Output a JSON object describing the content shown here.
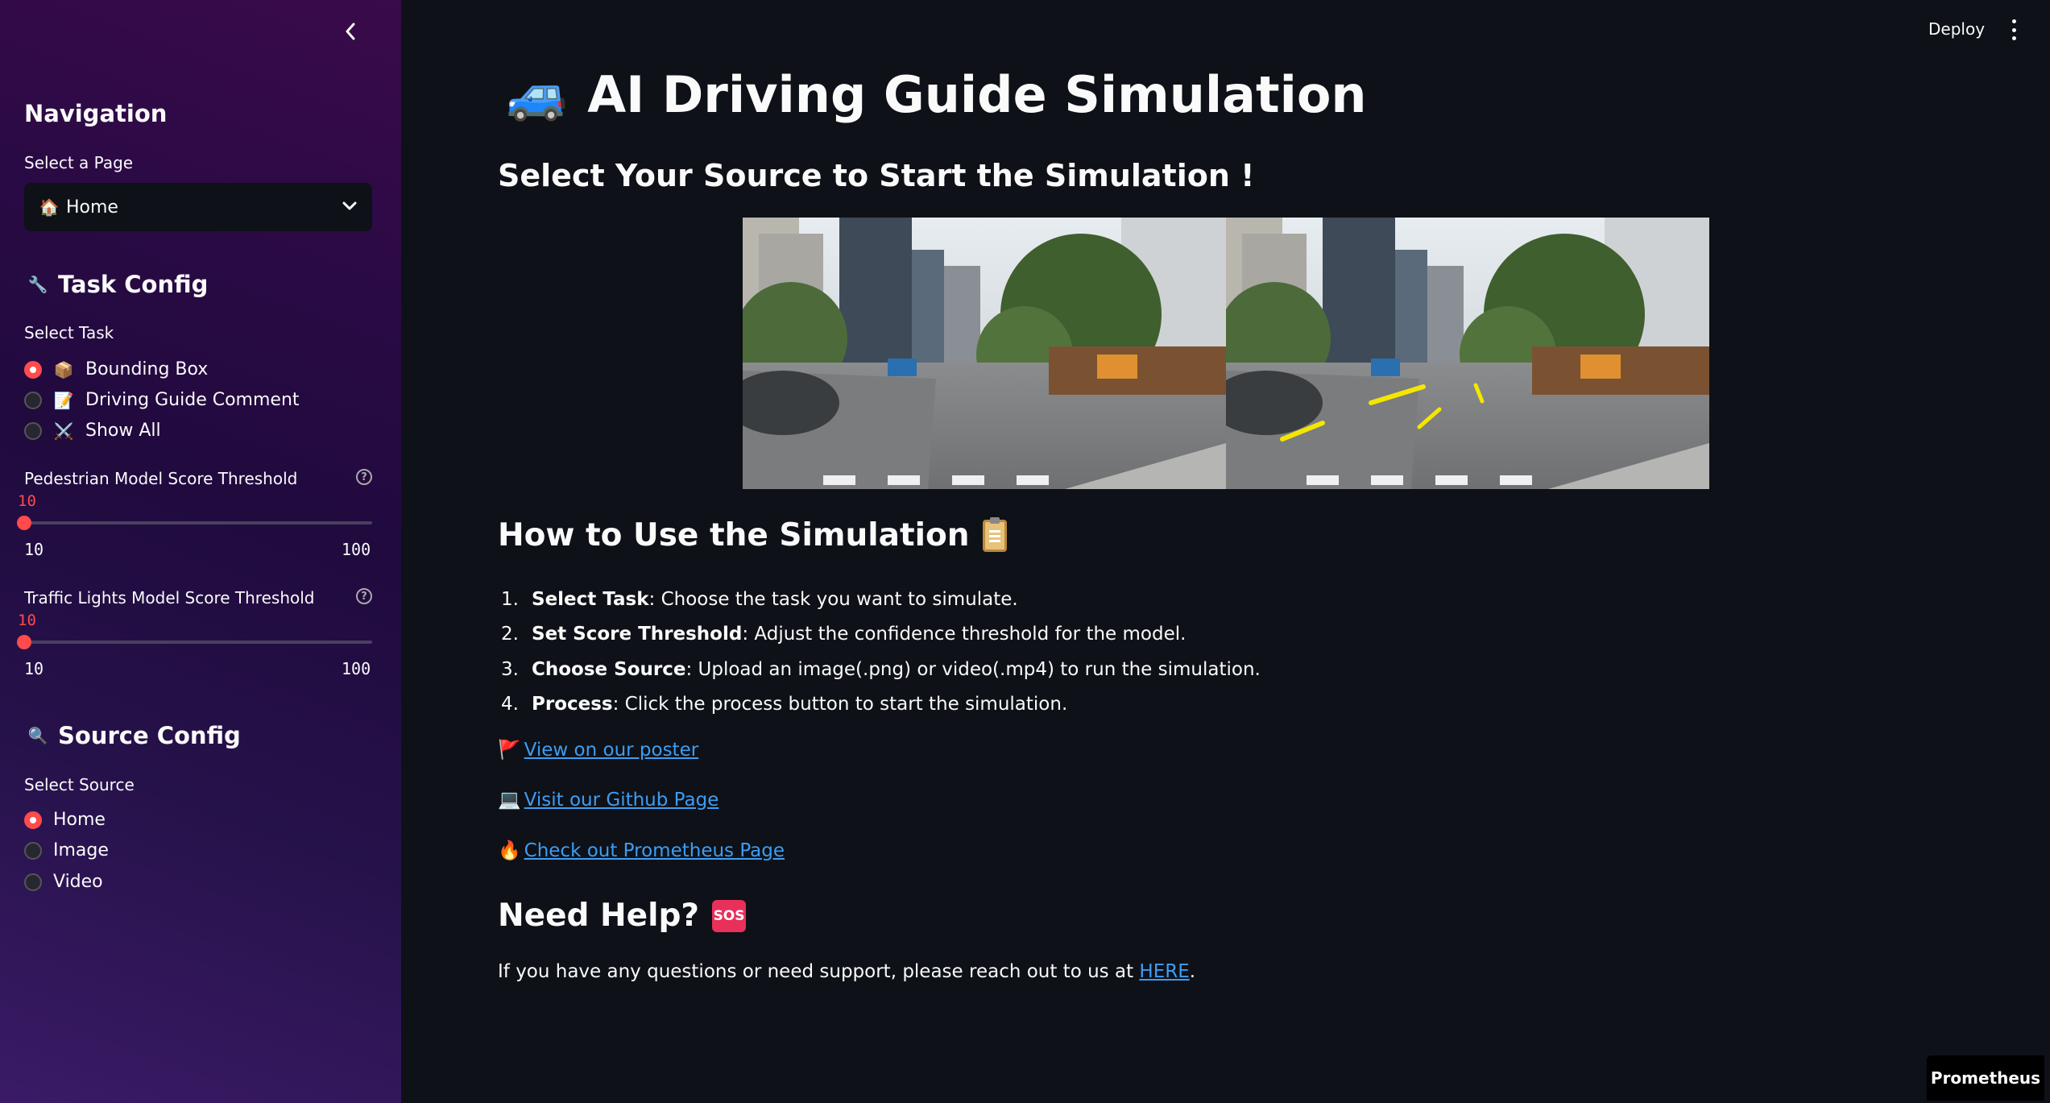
{
  "sidebar": {
    "navigation_title": "Navigation",
    "select_page_label": "Select a Page",
    "page_select": {
      "icon": "🏠",
      "value": "Home"
    },
    "task_config_icon": "🔧",
    "task_config_title": "Task Config",
    "select_task_label": "Select Task",
    "tasks": [
      {
        "icon": "📦",
        "label": "Bounding Box",
        "selected": true
      },
      {
        "icon": "📝",
        "label": "Driving Guide Comment",
        "selected": false
      },
      {
        "icon": "⚔️",
        "label": "Show All",
        "selected": false
      }
    ],
    "pedestrian_slider": {
      "label": "Pedestrian Model Score Threshold",
      "value": "10",
      "min": "10",
      "max": "100"
    },
    "traffic_slider": {
      "label": "Traffic Lights Model Score Threshold",
      "value": "10",
      "min": "10",
      "max": "100"
    },
    "source_config_icon": "🔍",
    "source_config_title": "Source Config",
    "select_source_label": "Select Source",
    "sources": [
      {
        "label": "Home",
        "selected": true
      },
      {
        "label": "Image",
        "selected": false
      },
      {
        "label": "Video",
        "selected": false
      }
    ]
  },
  "header": {
    "deploy_label": "Deploy"
  },
  "main": {
    "title_icon": "🚙",
    "title": "AI Driving Guide Simulation",
    "subtitle": "Select Your Source to Start the Simulation !",
    "how_to_title": "How to Use the Simulation",
    "steps": [
      {
        "num": "1.",
        "bold": "Select Task",
        "text": ": Choose the task you want to simulate."
      },
      {
        "num": "2.",
        "bold": "Set Score Threshold",
        "text": ": Adjust the confidence threshold for the model."
      },
      {
        "num": "3.",
        "bold": "Choose Source",
        "text": ": Upload an image(.png) or video(.mp4) to run the simulation."
      },
      {
        "num": "4.",
        "bold": "Process",
        "text": ": Click the process button to start the simulation."
      }
    ],
    "links": [
      {
        "icon": "🚩",
        "text": "View on our poster"
      },
      {
        "icon": "💻",
        "text": "Visit our Github Page"
      },
      {
        "icon": "🔥",
        "text": "Check out Prometheus Page"
      }
    ],
    "need_help_title": "Need Help?",
    "sos_label": "SOS",
    "help_text": "If you have any questions or need support, please reach out to us at ",
    "help_link": "HERE",
    "help_end": "."
  },
  "footer_badge": "Prometheus",
  "colors": {
    "accent": "#ff4b4b",
    "link": "#3d9df3",
    "background": "#0e1117"
  }
}
